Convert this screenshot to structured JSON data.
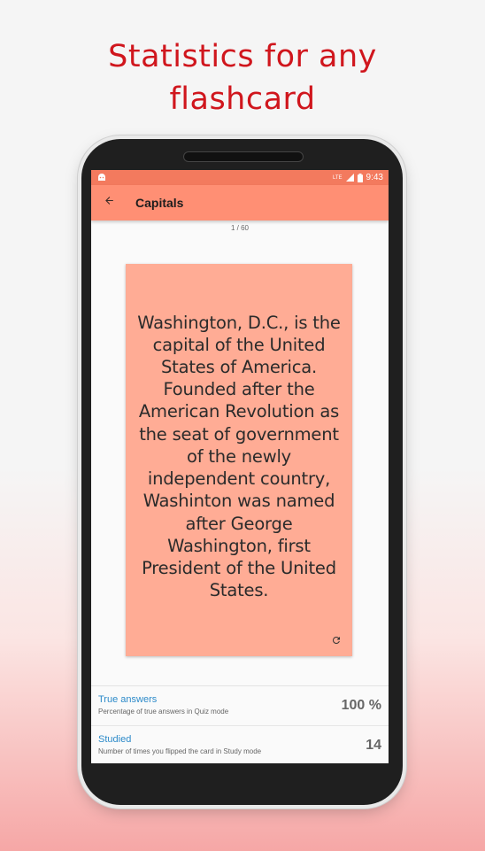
{
  "headline": {
    "line1": "Statistics for any",
    "line2": "flashcard"
  },
  "status_bar": {
    "time": "9:43",
    "network": "LTE"
  },
  "app_bar": {
    "title": "Capitals"
  },
  "card": {
    "counter": "1 / 60",
    "text": "Washington, D.C., is the capital of the United States of America. Founded after the American Revolution as the seat of government of the newly independent country, Washinton was named after George Washington, first President of the United States."
  },
  "stats": [
    {
      "label": "True answers",
      "description": "Percentage of true answers in Quiz mode",
      "value": "100 %"
    },
    {
      "label": "Studied",
      "description": "Number of times you flipped the card in Study mode",
      "value": "14"
    }
  ],
  "colors": {
    "accent": "#d0161d",
    "status_bar": "#f37a5e",
    "app_bar": "#ff8f74",
    "card": "#ffac95",
    "stat_label": "#2c8ac9"
  },
  "icons": {
    "status_left": "android-debug-icon",
    "signal": "signal-icon",
    "battery": "battery-icon",
    "back": "arrow-back-icon",
    "flip": "refresh-icon"
  }
}
